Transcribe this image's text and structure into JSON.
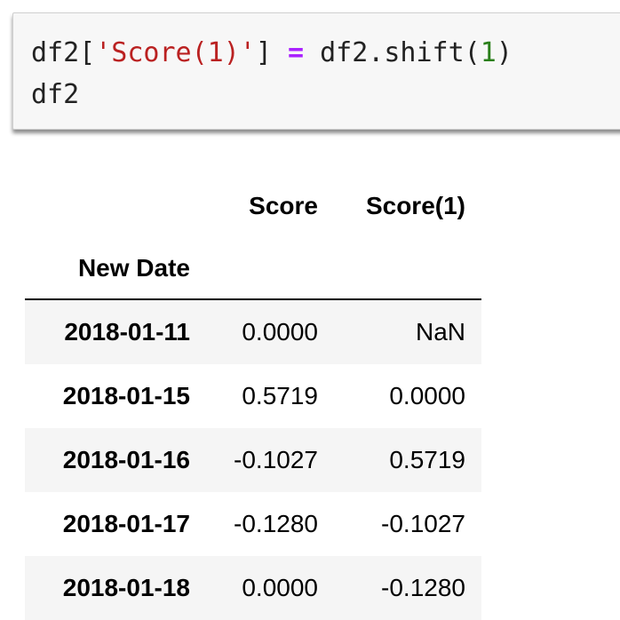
{
  "code_cell": {
    "line1": {
      "a": "df2[",
      "string": "'Score(1)'",
      "b": "] ",
      "op": "=",
      "c": " df2.shift(",
      "num": "1",
      "d": ")"
    },
    "line2": "df2"
  },
  "dataframe": {
    "columns": [
      "Score",
      "Score(1)"
    ],
    "index_name": "New Date",
    "rows": [
      {
        "index": "2018-01-11",
        "score": "0.0000",
        "score1": "NaN"
      },
      {
        "index": "2018-01-15",
        "score": "0.5719",
        "score1": "0.0000"
      },
      {
        "index": "2018-01-16",
        "score": "-0.1027",
        "score1": "0.5719"
      },
      {
        "index": "2018-01-17",
        "score": "-0.1280",
        "score1": "-0.1027"
      },
      {
        "index": "2018-01-18",
        "score": "0.0000",
        "score1": "-0.1280"
      }
    ]
  }
}
